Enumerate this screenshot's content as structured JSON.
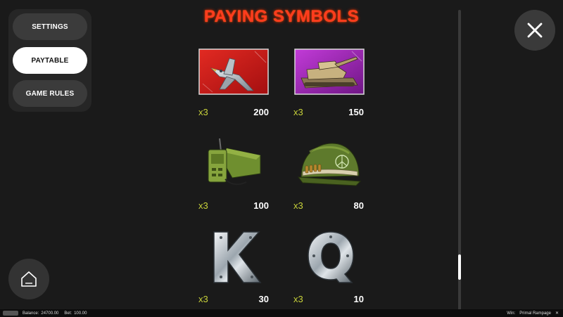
{
  "menu": {
    "settings_label": "SETTINGS",
    "paytable_label": "PAYTABLE",
    "game_rules_label": "GAME RULES",
    "active": "PAYTABLE"
  },
  "page": {
    "title": "PAYING SYMBOLS"
  },
  "symbols": [
    {
      "icon": "fighter-jet-icon",
      "multiplier": "x3",
      "payout": "200"
    },
    {
      "icon": "tank-icon",
      "multiplier": "x3",
      "payout": "150"
    },
    {
      "icon": "radio-icon",
      "multiplier": "x3",
      "payout": "100"
    },
    {
      "icon": "helmet-icon",
      "multiplier": "x3",
      "payout": "80"
    },
    {
      "icon": "letter-k-icon",
      "letter": "K",
      "multiplier": "x3",
      "payout": "30"
    },
    {
      "icon": "letter-q-icon",
      "letter": "Q",
      "multiplier": "x3",
      "payout": "10"
    }
  ],
  "footer": {
    "balance_label": "Balance:",
    "balance_value": "24700.00",
    "bet_label": "Bet:",
    "bet_value": "100.00",
    "win_label": "Win:",
    "game_name": "Primal Rampage"
  },
  "colors": {
    "title": "#ff3b1f",
    "multiplier": "#c8d23a",
    "background": "#1a1a1a"
  }
}
